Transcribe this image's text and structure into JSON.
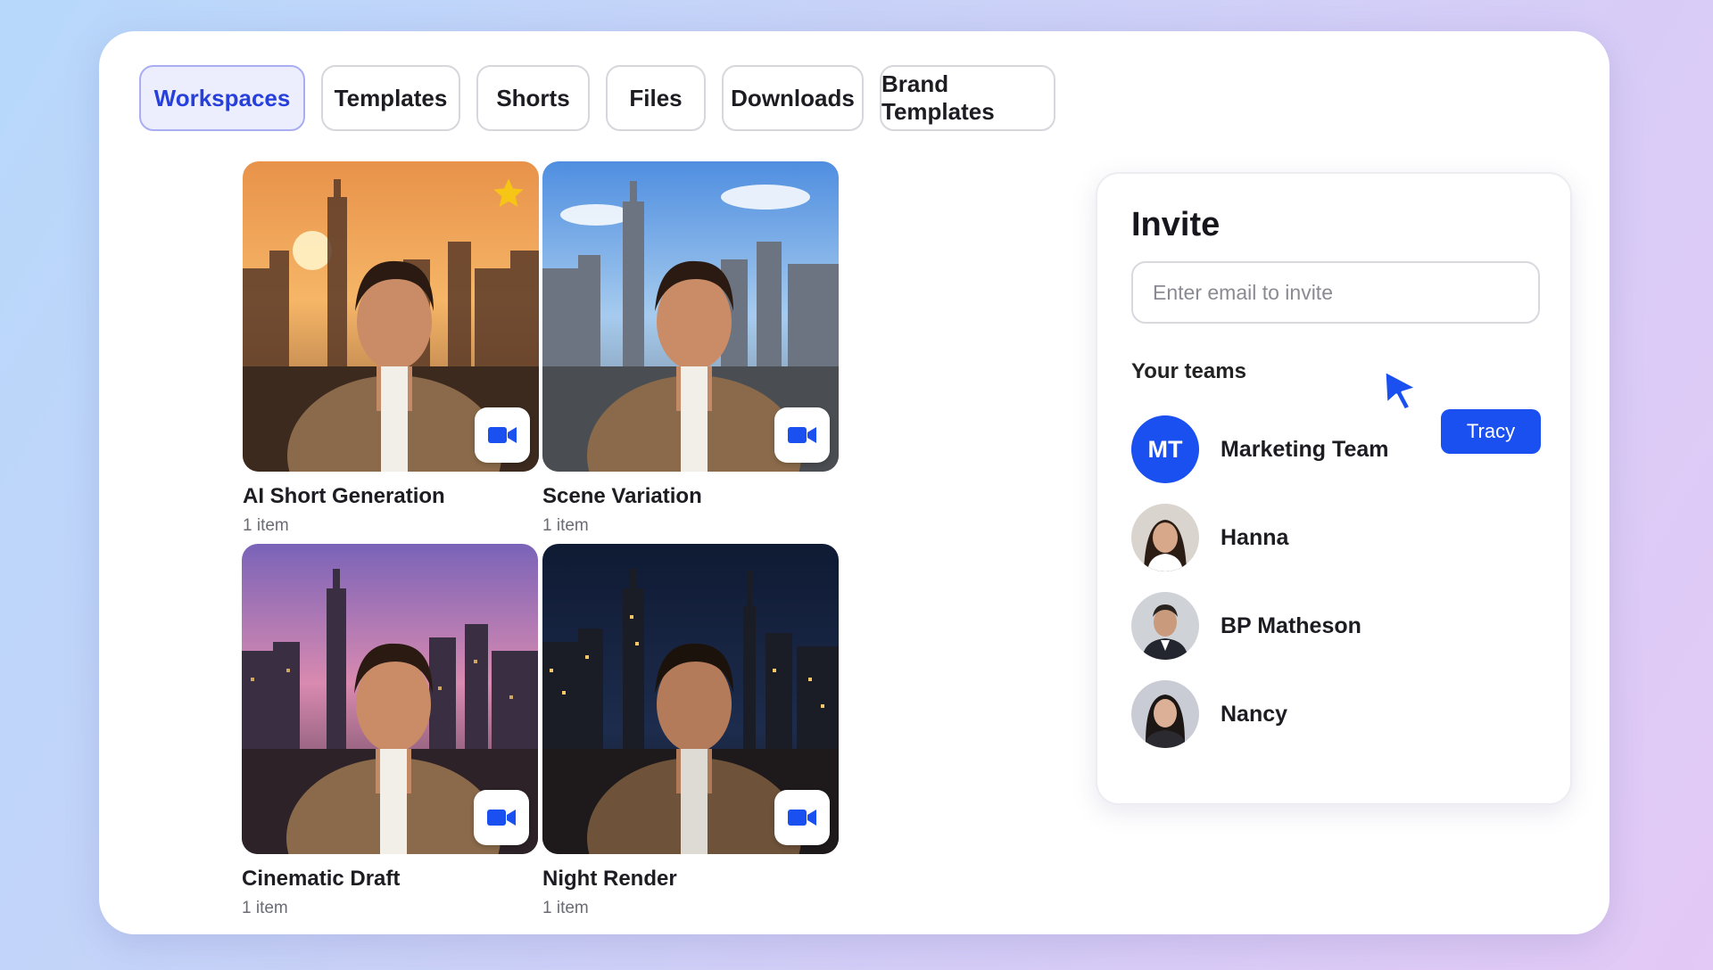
{
  "tabs": [
    {
      "label": "Workspaces",
      "active": true
    },
    {
      "label": "Templates",
      "active": false
    },
    {
      "label": "Shorts",
      "active": false
    },
    {
      "label": "Files",
      "active": false
    },
    {
      "label": "Downloads",
      "active": false
    },
    {
      "label": "Brand Templates",
      "active": false
    }
  ],
  "workspaces": [
    {
      "title": "AI Short Generation",
      "count": "1 item",
      "starred": true,
      "scene": "sunset",
      "badge_icon": "video-camera-icon"
    },
    {
      "title": "Scene Variation",
      "count": "1 item",
      "starred": false,
      "scene": "day",
      "badge_icon": "video-camera-icon"
    },
    {
      "title": "Cinematic Draft",
      "count": "1 item",
      "starred": false,
      "scene": "dusk",
      "badge_icon": "video-camera-icon"
    },
    {
      "title": "Night Render",
      "count": "1 item",
      "starred": false,
      "scene": "night",
      "badge_icon": "video-camera-icon"
    }
  ],
  "invite": {
    "title": "Invite",
    "email_placeholder": "Enter email to invite",
    "email_value": "",
    "teams_label": "Your teams",
    "cursor_tag": "Tracy",
    "members": [
      {
        "name": "Marketing Team",
        "initials": "MT",
        "type": "initials"
      },
      {
        "name": "Hanna",
        "type": "photo"
      },
      {
        "name": "BP Matheson",
        "type": "photo"
      },
      {
        "name": "Nancy",
        "type": "photo"
      }
    ]
  },
  "colors": {
    "accent": "#1a4ff0",
    "active_tab_bg": "#ecedfd",
    "active_tab_text": "#2740dc",
    "star": "#f7c516"
  }
}
